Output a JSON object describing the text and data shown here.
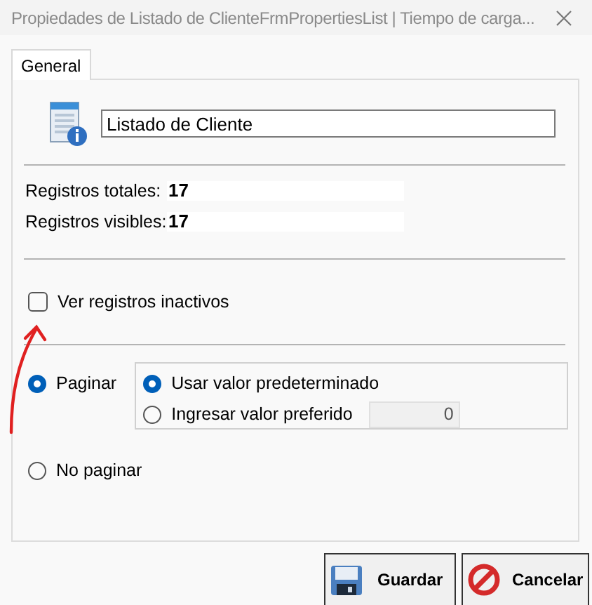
{
  "window": {
    "title": "Propiedades de Listado de ClienteFrmPropertiesList | Tiempo de carga..."
  },
  "tabs": [
    {
      "label": "General",
      "selected": true
    }
  ],
  "name_field": {
    "value": "Listado de Cliente"
  },
  "stats": [
    {
      "label": "Registros totales:",
      "value": "17"
    },
    {
      "label": "Registros visibles:",
      "value": "17"
    }
  ],
  "inactive_checkbox": {
    "label": "Ver registros inactivos",
    "checked": false
  },
  "paging": [
    {
      "label": "Paginar",
      "selected": true
    },
    {
      "label": "No paginar",
      "selected": false
    }
  ],
  "page_size": {
    "options": [
      {
        "label": "Usar valor predeterminado",
        "selected": true
      },
      {
        "label": "Ingresar valor preferido",
        "selected": false
      }
    ],
    "value": "0"
  },
  "buttons": [
    {
      "label": "Guardar",
      "kind": "save"
    },
    {
      "label": "Cancelar",
      "kind": "cancel"
    }
  ]
}
